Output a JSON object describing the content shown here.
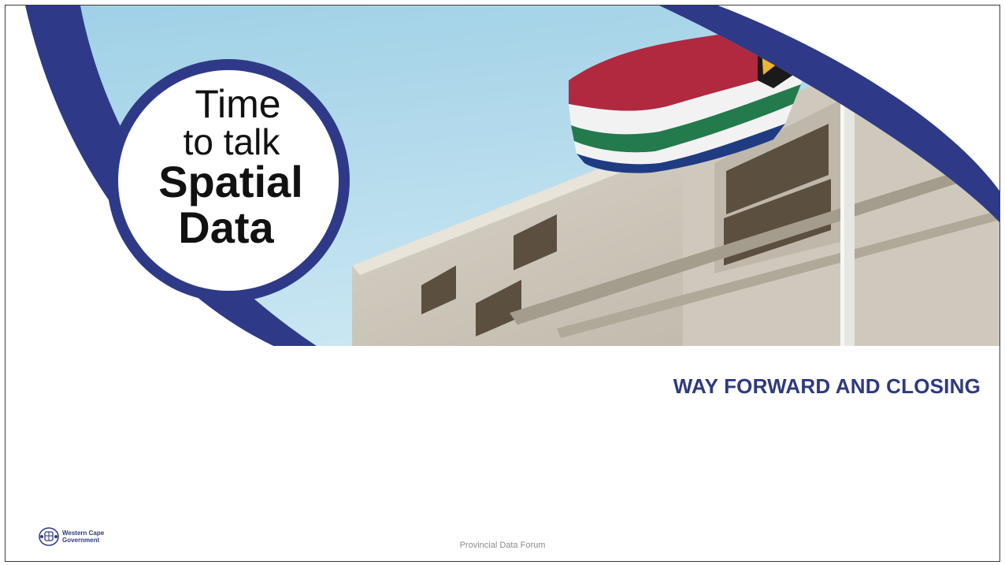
{
  "badge": {
    "line1": "Time",
    "line2": "to talk",
    "line3": "Spatial",
    "line4": "Data"
  },
  "section_title": "WAY FORWARD AND CLOSING",
  "footer": {
    "event": "Provincial Data Forum"
  },
  "logo": {
    "line1": "Western Cape",
    "line2": "Government"
  },
  "colors": {
    "brand_navy": "#2e3a87",
    "sky": "#a8d2e6",
    "building": "#c8c3b8"
  },
  "icons": {
    "logo": "western-cape-crest-icon"
  }
}
